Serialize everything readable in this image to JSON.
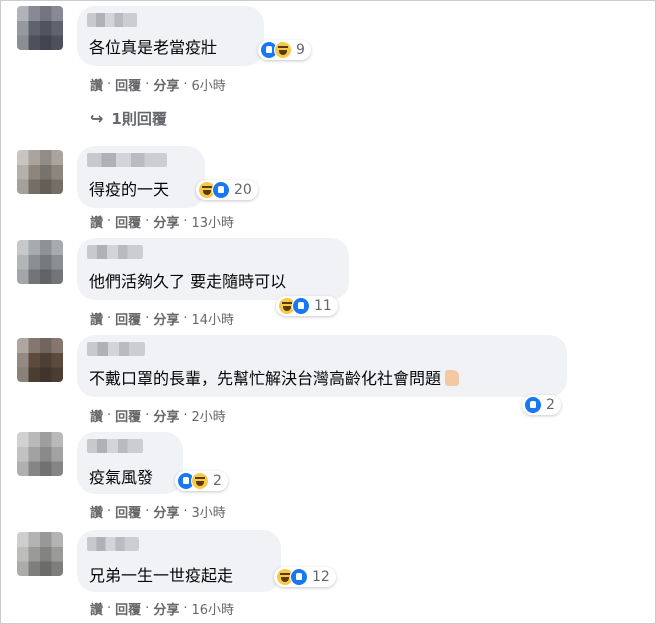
{
  "comments": [
    {
      "text": "各位真是老當疫壯",
      "reactions": [
        "like",
        "haha"
      ],
      "count": "9",
      "actions": {
        "like": "讚",
        "reply": "回覆",
        "share": "分享",
        "time": "6小時"
      },
      "avatar_color": "#6a6e78",
      "name_width": "med"
    },
    {
      "text": "得疫的一天",
      "reactions": [
        "haha",
        "like"
      ],
      "count": "20",
      "actions": {
        "like": "讚",
        "reply": "回覆",
        "share": "分享",
        "time": "13小時"
      },
      "avatar_color": "#8e867c"
    },
    {
      "text": "他們活夠久了 要走隨時可以",
      "reactions": [
        "haha",
        "like"
      ],
      "count": "11",
      "actions": {
        "like": "讚",
        "reply": "回覆",
        "share": "分享",
        "time": "14小時"
      },
      "avatar_color": "#8b8f93"
    },
    {
      "text": "不戴口罩的長輩，先幫忙解決台灣高齡化社會問題",
      "reactions": [
        "like"
      ],
      "count": "2",
      "actions": {
        "like": "讚",
        "reply": "回覆",
        "share": "分享",
        "time": "2小時"
      },
      "avatar_color": "#6c5a4c"
    },
    {
      "text": "疫氣風發",
      "reactions": [
        "like",
        "haha"
      ],
      "count": "2",
      "actions": {
        "like": "讚",
        "reply": "回覆",
        "share": "分享",
        "time": "3小時"
      },
      "avatar_color": "#a2a2a2"
    },
    {
      "text": "兄弟一生一世疫起走",
      "reactions": [
        "haha",
        "like"
      ],
      "count": "12",
      "actions": {
        "like": "讚",
        "reply": "回覆",
        "share": "分享",
        "time": "16小時"
      },
      "avatar_color": "#9a9a98"
    }
  ],
  "replies_link": "1則回覆",
  "colors": {
    "bubble": "#f0f2f5",
    "meta": "#65676b",
    "like": "#1877f2",
    "haha": "#f7c94a"
  }
}
